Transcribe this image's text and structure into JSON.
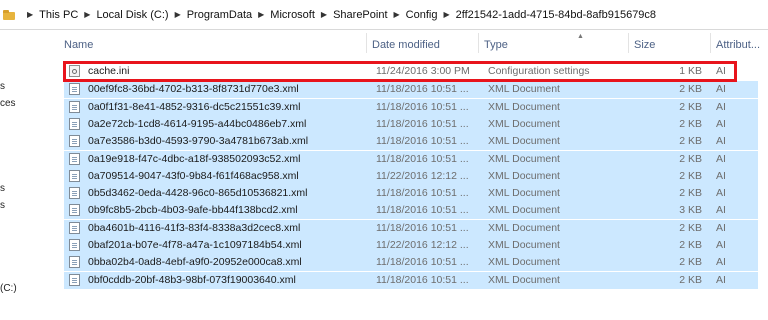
{
  "breadcrumb": [
    "This PC",
    "Local Disk (C:)",
    "ProgramData",
    "Microsoft",
    "SharePoint",
    "Config",
    "2ff21542-1add-4715-84bd-8afb915679c8"
  ],
  "nav": {
    "items": [
      "s",
      "ces",
      "s",
      "s",
      "(C:)"
    ]
  },
  "columns": {
    "name": "Name",
    "date": "Date modified",
    "type": "Type",
    "size": "Size",
    "attr": "Attribut..."
  },
  "files": [
    {
      "name": "cache.ini",
      "date": "11/24/2016 3:00 PM",
      "type": "Configuration settings",
      "size": "1 KB",
      "attr": "AI",
      "icon": "ini-settings-icon",
      "selected": false
    },
    {
      "name": "00ef9fc8-36bd-4702-b313-8f8731d770e3.xml",
      "date": "11/18/2016 10:51 ...",
      "type": "XML Document",
      "size": "2 KB",
      "attr": "AI",
      "icon": "xml-file-icon",
      "selected": true
    },
    {
      "name": "0a0f1f31-8e41-4852-9316-dc5c21551c39.xml",
      "date": "11/18/2016 10:51 ...",
      "type": "XML Document",
      "size": "2 KB",
      "attr": "AI",
      "icon": "xml-file-icon",
      "selected": true
    },
    {
      "name": "0a2e72cb-1cd8-4614-9195-a44bc0486eb7.xml",
      "date": "11/18/2016 10:51 ...",
      "type": "XML Document",
      "size": "2 KB",
      "attr": "AI",
      "icon": "xml-file-icon",
      "selected": true
    },
    {
      "name": "0a7e3586-b3d0-4593-9790-3a4781b673ab.xml",
      "date": "11/18/2016 10:51 ...",
      "type": "XML Document",
      "size": "2 KB",
      "attr": "AI",
      "icon": "xml-file-icon",
      "selected": true
    },
    {
      "name": "0a19e918-f47c-4dbc-a18f-938502093c52.xml",
      "date": "11/18/2016 10:51 ...",
      "type": "XML Document",
      "size": "2 KB",
      "attr": "AI",
      "icon": "xml-file-icon",
      "selected": true
    },
    {
      "name": "0a709514-9047-43f0-9b84-f61f468ac958.xml",
      "date": "11/22/2016 12:12 ...",
      "type": "XML Document",
      "size": "2 KB",
      "attr": "AI",
      "icon": "xml-file-icon",
      "selected": true
    },
    {
      "name": "0b5d3462-0eda-4428-96c0-865d10536821.xml",
      "date": "11/18/2016 10:51 ...",
      "type": "XML Document",
      "size": "2 KB",
      "attr": "AI",
      "icon": "xml-file-icon",
      "selected": true
    },
    {
      "name": "0b9fc8b5-2bcb-4b03-9afe-bb44f138bcd2.xml",
      "date": "11/18/2016 10:51 ...",
      "type": "XML Document",
      "size": "3 KB",
      "attr": "AI",
      "icon": "xml-file-icon",
      "selected": true
    },
    {
      "name": "0ba4601b-4116-41f3-83f4-8338a3d2cec8.xml",
      "date": "11/18/2016 10:51 ...",
      "type": "XML Document",
      "size": "2 KB",
      "attr": "AI",
      "icon": "xml-file-icon",
      "selected": true
    },
    {
      "name": "0baf201a-b07e-4f78-a47a-1c1097184b54.xml",
      "date": "11/22/2016 12:12 ...",
      "type": "XML Document",
      "size": "2 KB",
      "attr": "AI",
      "icon": "xml-file-icon",
      "selected": true
    },
    {
      "name": "0bba02b4-0ad8-4ebf-a9f0-20952e000ca8.xml",
      "date": "11/18/2016 10:51 ...",
      "type": "XML Document",
      "size": "2 KB",
      "attr": "AI",
      "icon": "xml-file-icon",
      "selected": true
    },
    {
      "name": "0bf0cddb-20bf-48b3-98bf-073f19003640.xml",
      "date": "11/18/2016 10:51 ...",
      "type": "XML Document",
      "size": "2 KB",
      "attr": "AI",
      "icon": "xml-file-icon",
      "selected": true
    }
  ],
  "colors": {
    "selection": "#cce8ff",
    "highlight": "#e8141c",
    "header_text": "#4d6185"
  }
}
